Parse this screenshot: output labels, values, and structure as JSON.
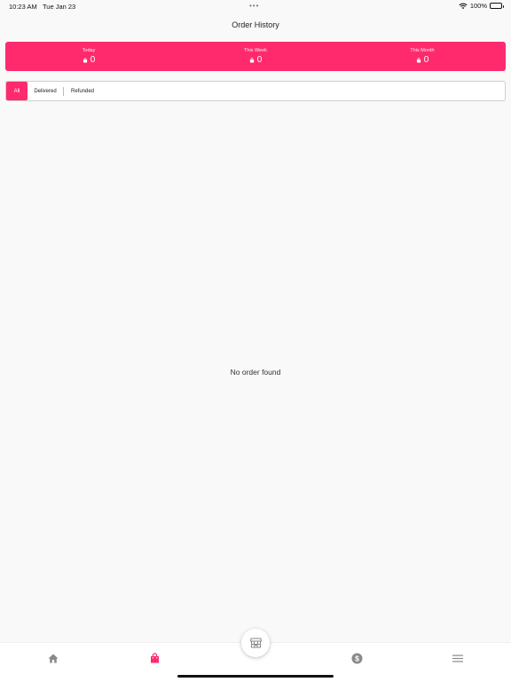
{
  "status_bar": {
    "time": "10:23 AM",
    "date": "Tue Jan 23",
    "battery": "100%",
    "dots": "•••"
  },
  "header": {
    "title": "Order History"
  },
  "summary": {
    "items": [
      {
        "label": "Today",
        "value": "0"
      },
      {
        "label": "This Week",
        "value": "0"
      },
      {
        "label": "This Month",
        "value": "0"
      }
    ]
  },
  "filters": {
    "all": "All",
    "delivered": "Delivered",
    "refunded": "Refunded",
    "selected": "All"
  },
  "empty_state": {
    "message": "No order found"
  },
  "bottom_nav": {
    "items": [
      "home-icon",
      "shopping-bag-icon",
      "store-icon",
      "dollar-icon",
      "menu-icon"
    ],
    "active": "shopping-bag-icon"
  },
  "colors": {
    "accent": "#ff2a6d",
    "icon_inactive": "#8a8a8a"
  }
}
